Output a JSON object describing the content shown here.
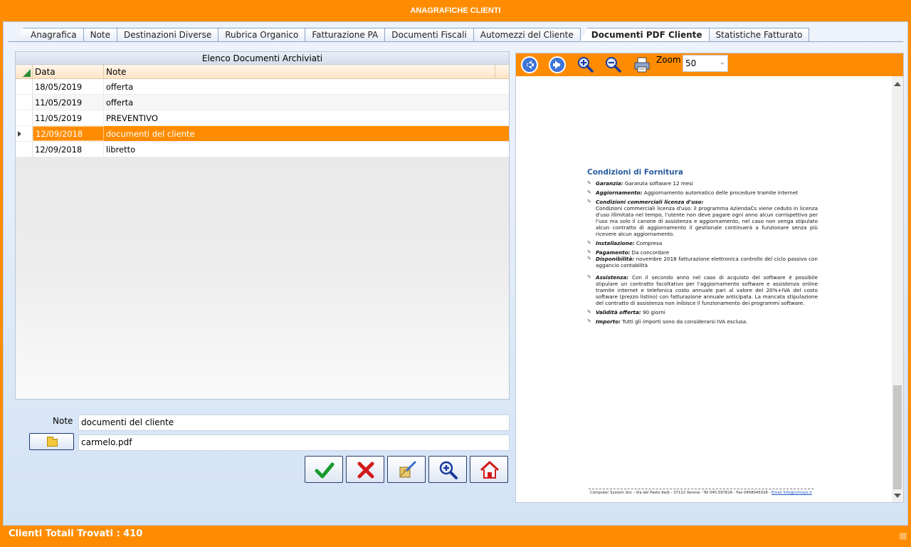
{
  "window": {
    "title": "ANAGRAFICHE CLIENTI"
  },
  "tabs": [
    {
      "label": "Anagrafica"
    },
    {
      "label": "Note"
    },
    {
      "label": "Destinazioni Diverse"
    },
    {
      "label": "Rubrica Organico"
    },
    {
      "label": "Fatturazione PA"
    },
    {
      "label": "Documenti Fiscali"
    },
    {
      "label": "Automezzi del Cliente"
    },
    {
      "label": "Documenti PDF Cliente",
      "active": true
    },
    {
      "label": "Statistiche Fatturato"
    }
  ],
  "grid": {
    "caption": "Elenco Documenti Archiviati",
    "columns": [
      "Data",
      "Note"
    ],
    "rows": [
      {
        "data": "18/05/2019",
        "note": "offerta"
      },
      {
        "data": "11/05/2019",
        "note": "offerta"
      },
      {
        "data": "11/05/2019",
        "note": "PREVENTIVO"
      },
      {
        "data": "12/09/2018",
        "note": "documenti del cliente",
        "selected": true
      },
      {
        "data": "12/09/2018",
        "note": "libretto"
      }
    ]
  },
  "form": {
    "note_label": "Note",
    "note_value": "documenti del cliente",
    "file_value": "carmelo.pdf",
    "folder_icon": "folder-icon"
  },
  "actions": [
    {
      "name": "confirm",
      "icon": "check-icon"
    },
    {
      "name": "cancel",
      "icon": "cross-icon"
    },
    {
      "name": "clean",
      "icon": "broom-icon"
    },
    {
      "name": "search",
      "icon": "magnifier-icon"
    },
    {
      "name": "home",
      "icon": "home-icon"
    }
  ],
  "preview": {
    "zoom_label": "Zoom",
    "zoom_value": "50",
    "document": {
      "title": "Condizioni di Fornitura",
      "items": [
        {
          "label": "Garanzia:",
          "text": " Garanzia software 12 mesi"
        },
        {
          "label": "Aggiornamento:",
          "text": " Aggiornamento automatico delle procedure tramite internet"
        },
        {
          "label": "Condizioni commerciali licenza d'uso:",
          "text": " Condizioni commerciali licenza d'uso: il programma AziendaCs viene ceduto in licenza d'uso illimitata nel tempo, l'utente non deve pagare ogni anno alcun corrispettivo per l'uso ma solo il canone di assistenza e aggiornamento, nel caso non venga stipulato alcun contratto di aggiornamento il gestionale continuerà a funzionare senza più ricevere alcun aggiornamento."
        },
        {
          "label": "Installazione:",
          "text": " Compresa"
        },
        {
          "label": "Pagamento:",
          "text": " Da concordare"
        },
        {
          "label": "Disponibilità:",
          "text": " novembre 2018 fatturazione elettronica controllo del ciclo passivo con aggancio contabilità"
        },
        {
          "label": "Assistenza:",
          "text": " Con il secondo anno nel caso di acquisto del software è possibile stipulare un contratto facoltativo per l'aggiornamento software e assistenza online tramite internet e telefonica costo annuale pari al valore del 20%+IVA del costo software (prezzo listino) con fatturazione annuale anticipata. La mancata stipulazione del contratto di assistenza non inibisce il funzionamento dei programmi software."
        },
        {
          "label": "Validità offerta:",
          "text": " 90 giorni"
        },
        {
          "label": "Importo:",
          "text": " Tutti gli importi sono da considerarsi IVA esclusa."
        }
      ],
      "footer": "Computer System Snc - Via del Pasto 9a/b - 37122 Verona - Tel 045.597616 - Fax 0458045028 - ",
      "footer_link": "Email info@comsys.it"
    }
  },
  "status": {
    "text": "Clienti Totali Trovati : 410"
  },
  "colors": {
    "accent": "#ff8c00",
    "selected_row": "#ff8c00",
    "doc_title": "#2b5c9e"
  }
}
